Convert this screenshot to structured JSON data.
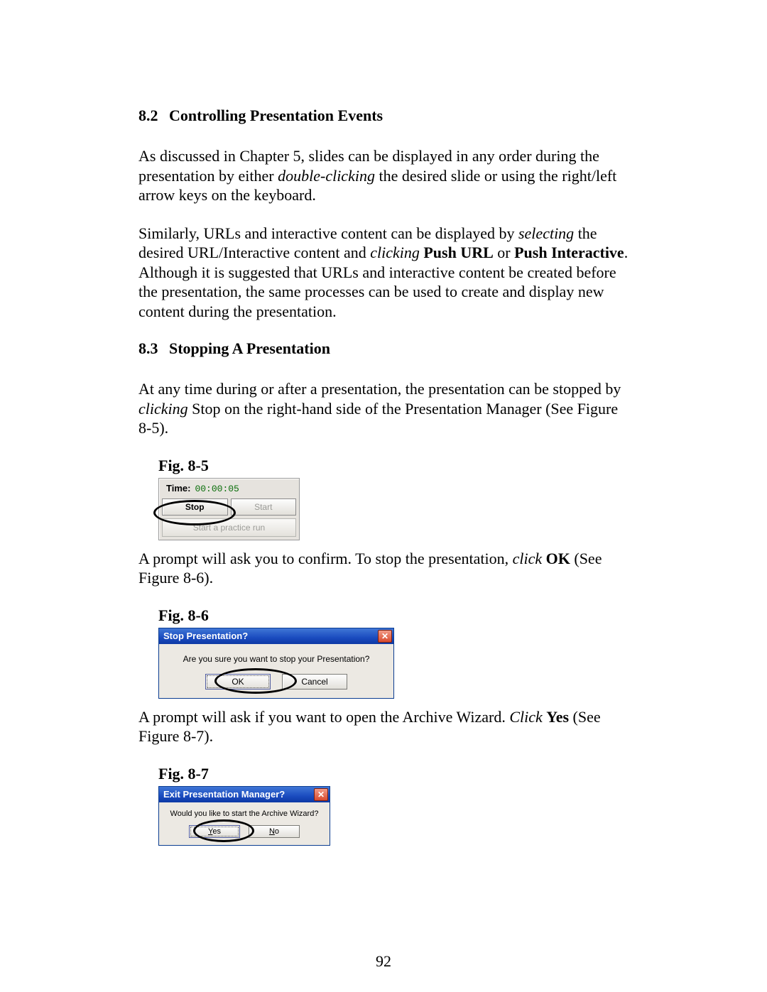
{
  "page_number": "92",
  "sections": {
    "s82": {
      "number": "8.2",
      "title": "Controlling Presentation Events",
      "p1a": "As discussed in Chapter 5, slides can be displayed in any order during the presentation by either ",
      "p1_i1": "double-clicking",
      "p1b": " the desired slide or using the right/left arrow keys on the keyboard.",
      "p2a": "Similarly, URLs and interactive content can be displayed by ",
      "p2_i1": "selecting",
      "p2b": " the desired URL/Interactive content and ",
      "p2_i2": "clicking",
      "p2c": " ",
      "p2_b1": "Push URL",
      "p2d": " or ",
      "p2_b2": "Push Interactive",
      "p2e": ".  Although it is suggested that URLs and interactive content be created before the presentation, the same processes can be used to create and display new content during the presentation."
    },
    "s83": {
      "number": "8.3",
      "title": "Stopping A Presentation",
      "p1a": "At any time during or after a presentation, the presentation can be stopped by ",
      "p1_i1": "clicking",
      "p1b": " Stop on the right-hand side of the Presentation Manager (See Figure 8-5).",
      "p2a": "A prompt will ask you to confirm.  To stop the presentation, ",
      "p2_i1": "click",
      "p2b": " ",
      "p2_b1": "OK",
      "p2c": " (See Figure 8-6).",
      "p3a": "A prompt will ask if you want to open the Archive Wizard.  ",
      "p3_i1": "Click",
      "p3b": " ",
      "p3_b1": "Yes",
      "p3c": " (See Figure 8-7)."
    }
  },
  "figures": {
    "fig85": {
      "caption": "Fig. 8-5",
      "time_label": "Time:",
      "time_value": "00:00:05",
      "stop": "Stop",
      "start": "Start",
      "practice": "Start a practice run"
    },
    "fig86": {
      "caption": "Fig. 8-6",
      "title": "Stop Presentation?",
      "message": "Are you sure you want to stop your Presentation?",
      "ok": "OK",
      "cancel": "Cancel"
    },
    "fig87": {
      "caption": "Fig. 8-7",
      "title": "Exit Presentation Manager?",
      "message": "Would you like to start the Archive Wizard?",
      "yes_u": "Y",
      "yes_r": "es",
      "no_u": "N",
      "no_r": "o"
    }
  }
}
